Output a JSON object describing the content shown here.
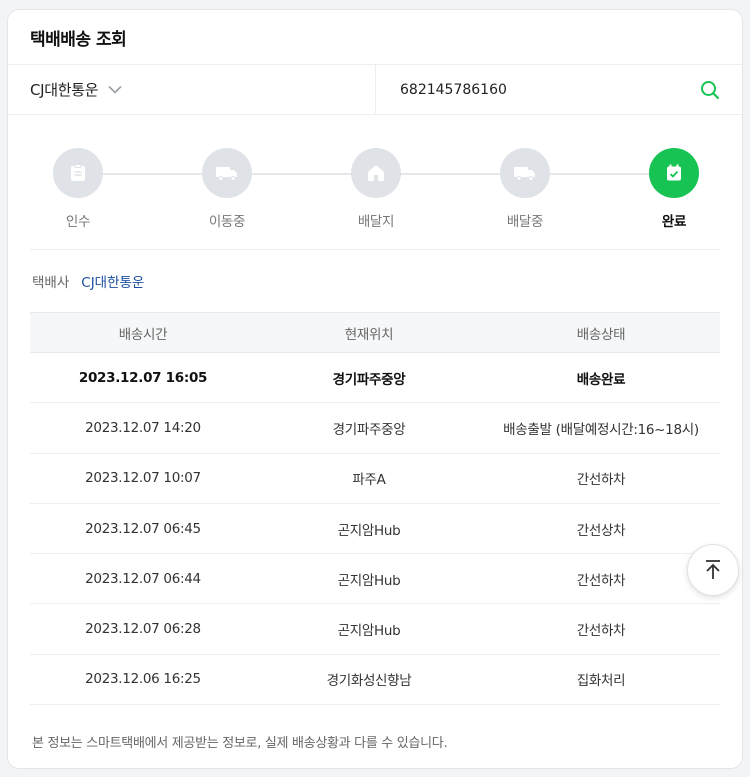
{
  "header": {
    "title": "택배배송 조회"
  },
  "search": {
    "carrier": "CJ대한통운",
    "tracking_number": "682145786160"
  },
  "steps": [
    {
      "label": "인수",
      "icon": "receipt-icon",
      "active": false
    },
    {
      "label": "이동중",
      "icon": "truck-icon",
      "active": false
    },
    {
      "label": "배달지",
      "icon": "house-icon",
      "active": false
    },
    {
      "label": "배달중",
      "icon": "delivery-truck-icon",
      "active": false
    },
    {
      "label": "완료",
      "icon": "calendar-check-icon",
      "active": true
    }
  ],
  "courier": {
    "label": "택배사",
    "name": "CJ대한통운"
  },
  "history": {
    "headers": [
      "배송시간",
      "현재위치",
      "배송상태"
    ],
    "rows": [
      {
        "time": "2023.12.07 16:05",
        "location": "경기파주중앙",
        "status": "배송완료"
      },
      {
        "time": "2023.12.07 14:20",
        "location": "경기파주중앙",
        "status": "배송출발 (배달예정시간:16~18시)"
      },
      {
        "time": "2023.12.07 10:07",
        "location": "파주A",
        "status": "간선하차"
      },
      {
        "time": "2023.12.07 06:45",
        "location": "곤지암Hub",
        "status": "간선상차"
      },
      {
        "time": "2023.12.07 06:44",
        "location": "곤지암Hub",
        "status": "간선하차"
      },
      {
        "time": "2023.12.07 06:28",
        "location": "곤지암Hub",
        "status": "간선하차"
      },
      {
        "time": "2023.12.06 16:25",
        "location": "경기화성신향남",
        "status": "집화처리"
      }
    ]
  },
  "notice": "본 정보는 스마트택배에서 제공받는 정보로, 실제 배송상황과 다를 수 있습니다.",
  "colors": {
    "accent": "#17c352",
    "step_inactive": "#dfe2e6",
    "link": "#1c4fa0"
  }
}
